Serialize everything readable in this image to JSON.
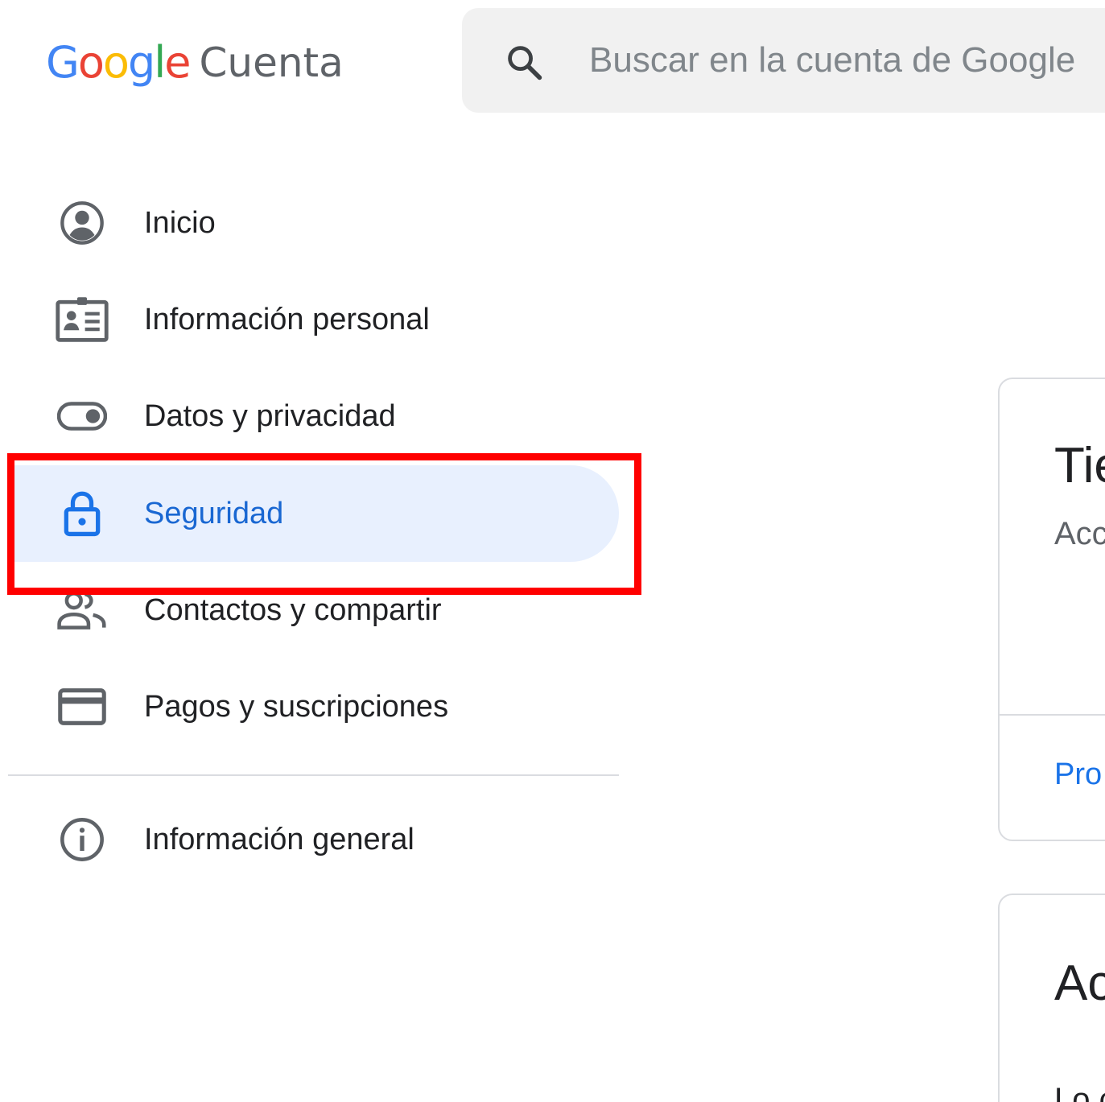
{
  "header": {
    "logo_google": "Google",
    "logo_product": "Cuenta",
    "search": {
      "placeholder": "Buscar en la cuenta de Google",
      "value": ""
    }
  },
  "sidebar": {
    "items": [
      {
        "label": "Inicio",
        "icon": "account-circle-icon"
      },
      {
        "label": "Información personal",
        "icon": "id-card-icon"
      },
      {
        "label": "Datos y privacidad",
        "icon": "toggle-icon"
      },
      {
        "label": "Seguridad",
        "icon": "lock-icon",
        "active": true
      },
      {
        "label": "Contactos y compartir",
        "icon": "people-icon"
      },
      {
        "label": "Pagos y suscripciones",
        "icon": "credit-card-icon"
      }
    ],
    "footer_items": [
      {
        "label": "Información general",
        "icon": "info-icon"
      }
    ]
  },
  "cards": [
    {
      "title": "Tie",
      "description": "Acc",
      "link": "Pro"
    },
    {
      "title": "Ac",
      "description": "Lo c"
    }
  ],
  "colors": {
    "accent": "#1a73e8",
    "active_bg": "#e8f0fe",
    "active_text": "#1967d2",
    "highlight": "#ff0000",
    "icon_gray": "#5f6368",
    "google_blue": "#4285F4",
    "google_red": "#EA4335",
    "google_yellow": "#FBBC05",
    "google_green": "#34A853"
  }
}
